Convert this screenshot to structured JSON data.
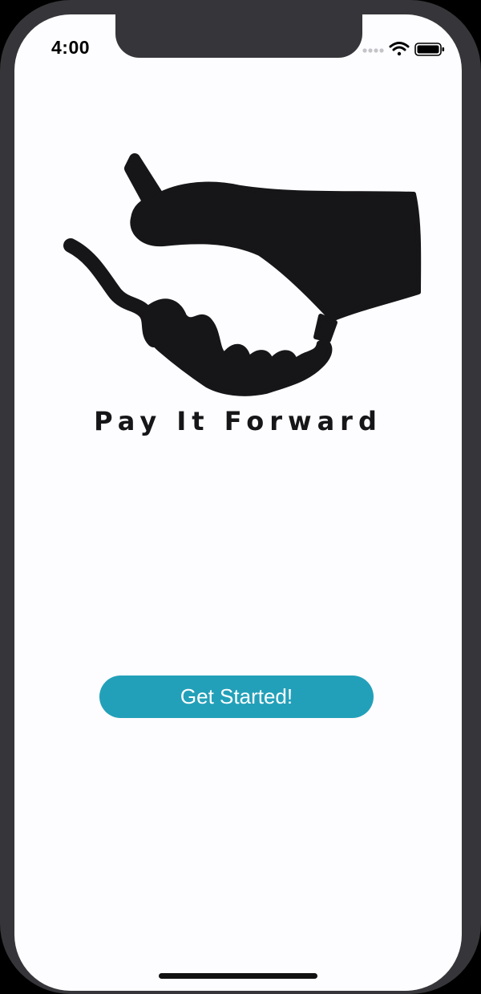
{
  "status_bar": {
    "time": "4:00",
    "icons": [
      "signal-dots-icon",
      "wifi-icon",
      "battery-icon"
    ]
  },
  "logo": {
    "icon": "handshake-icon",
    "title": "Pay It Forward"
  },
  "actions": {
    "get_started_label": "Get Started!"
  },
  "colors": {
    "accent": "#23a0b9",
    "background": "#fdfcfe",
    "logo": "#161517",
    "frame": "#36363a"
  }
}
